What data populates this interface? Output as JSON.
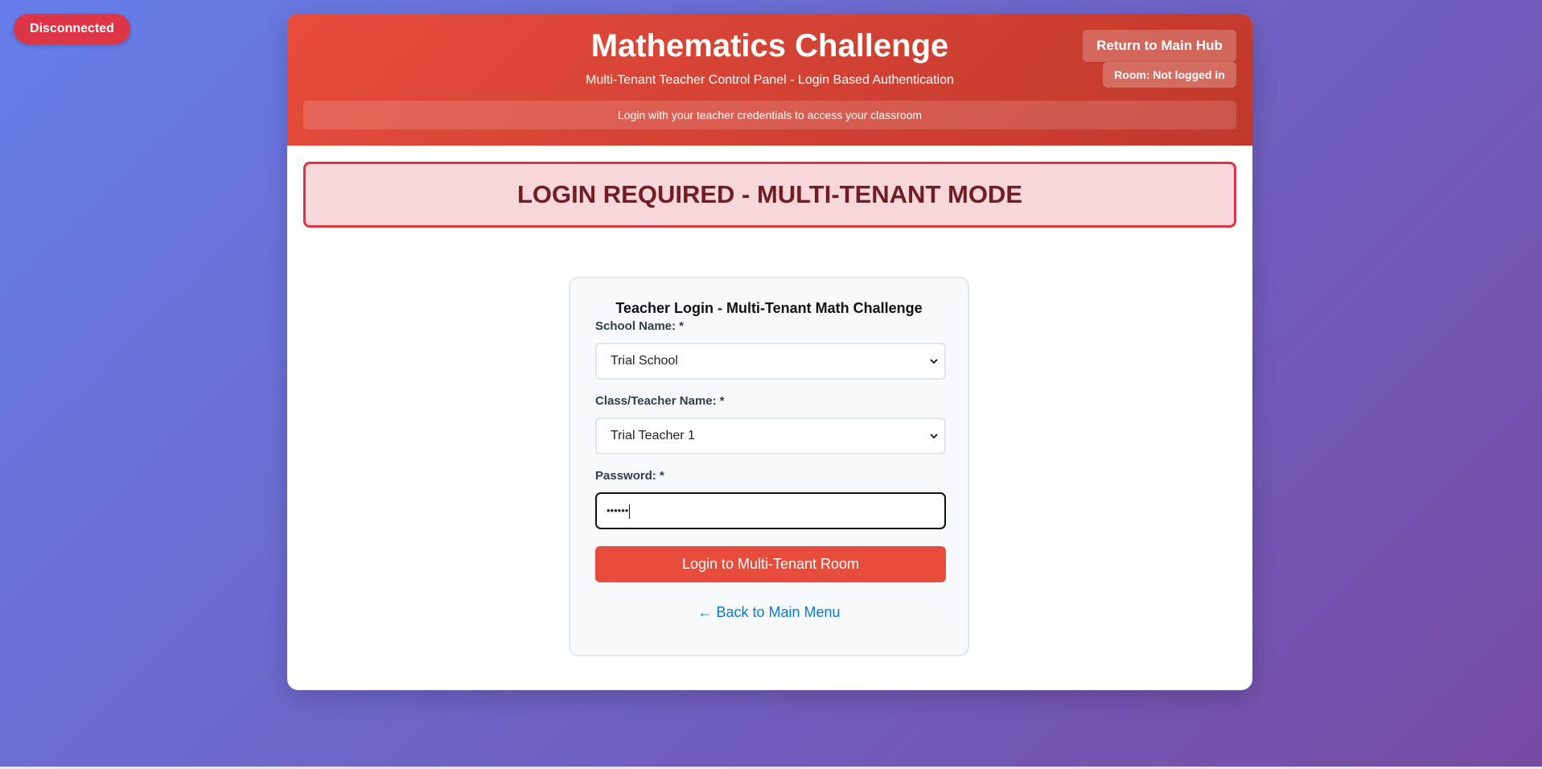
{
  "connection": {
    "status": "Disconnected"
  },
  "header": {
    "title": "Mathematics Challenge",
    "subtitle": "Multi-Tenant Teacher Control Panel - Login Based Authentication",
    "info": "Login with your teacher credentials to access your classroom",
    "hub_button": "Return to Main Hub",
    "room_badge": "Room: Not logged in"
  },
  "alert": {
    "text": "LOGIN REQUIRED - MULTI-TENANT MODE"
  },
  "login": {
    "title": "Teacher Login - Multi-Tenant Math Challenge",
    "school_label": "School Name: *",
    "school_value": "Trial School",
    "class_label": "Class/Teacher Name: *",
    "class_value": "Trial Teacher 1",
    "password_label": "Password: *",
    "password_masked": "••••••",
    "submit_label": "Login to Multi-Tenant Room",
    "back_link": "← Back to Main Menu"
  },
  "colors": {
    "header_red": "#e74c3c",
    "alert_text": "#721c24",
    "link_blue": "#0a7bd6",
    "disconnected": "#dc3545"
  }
}
